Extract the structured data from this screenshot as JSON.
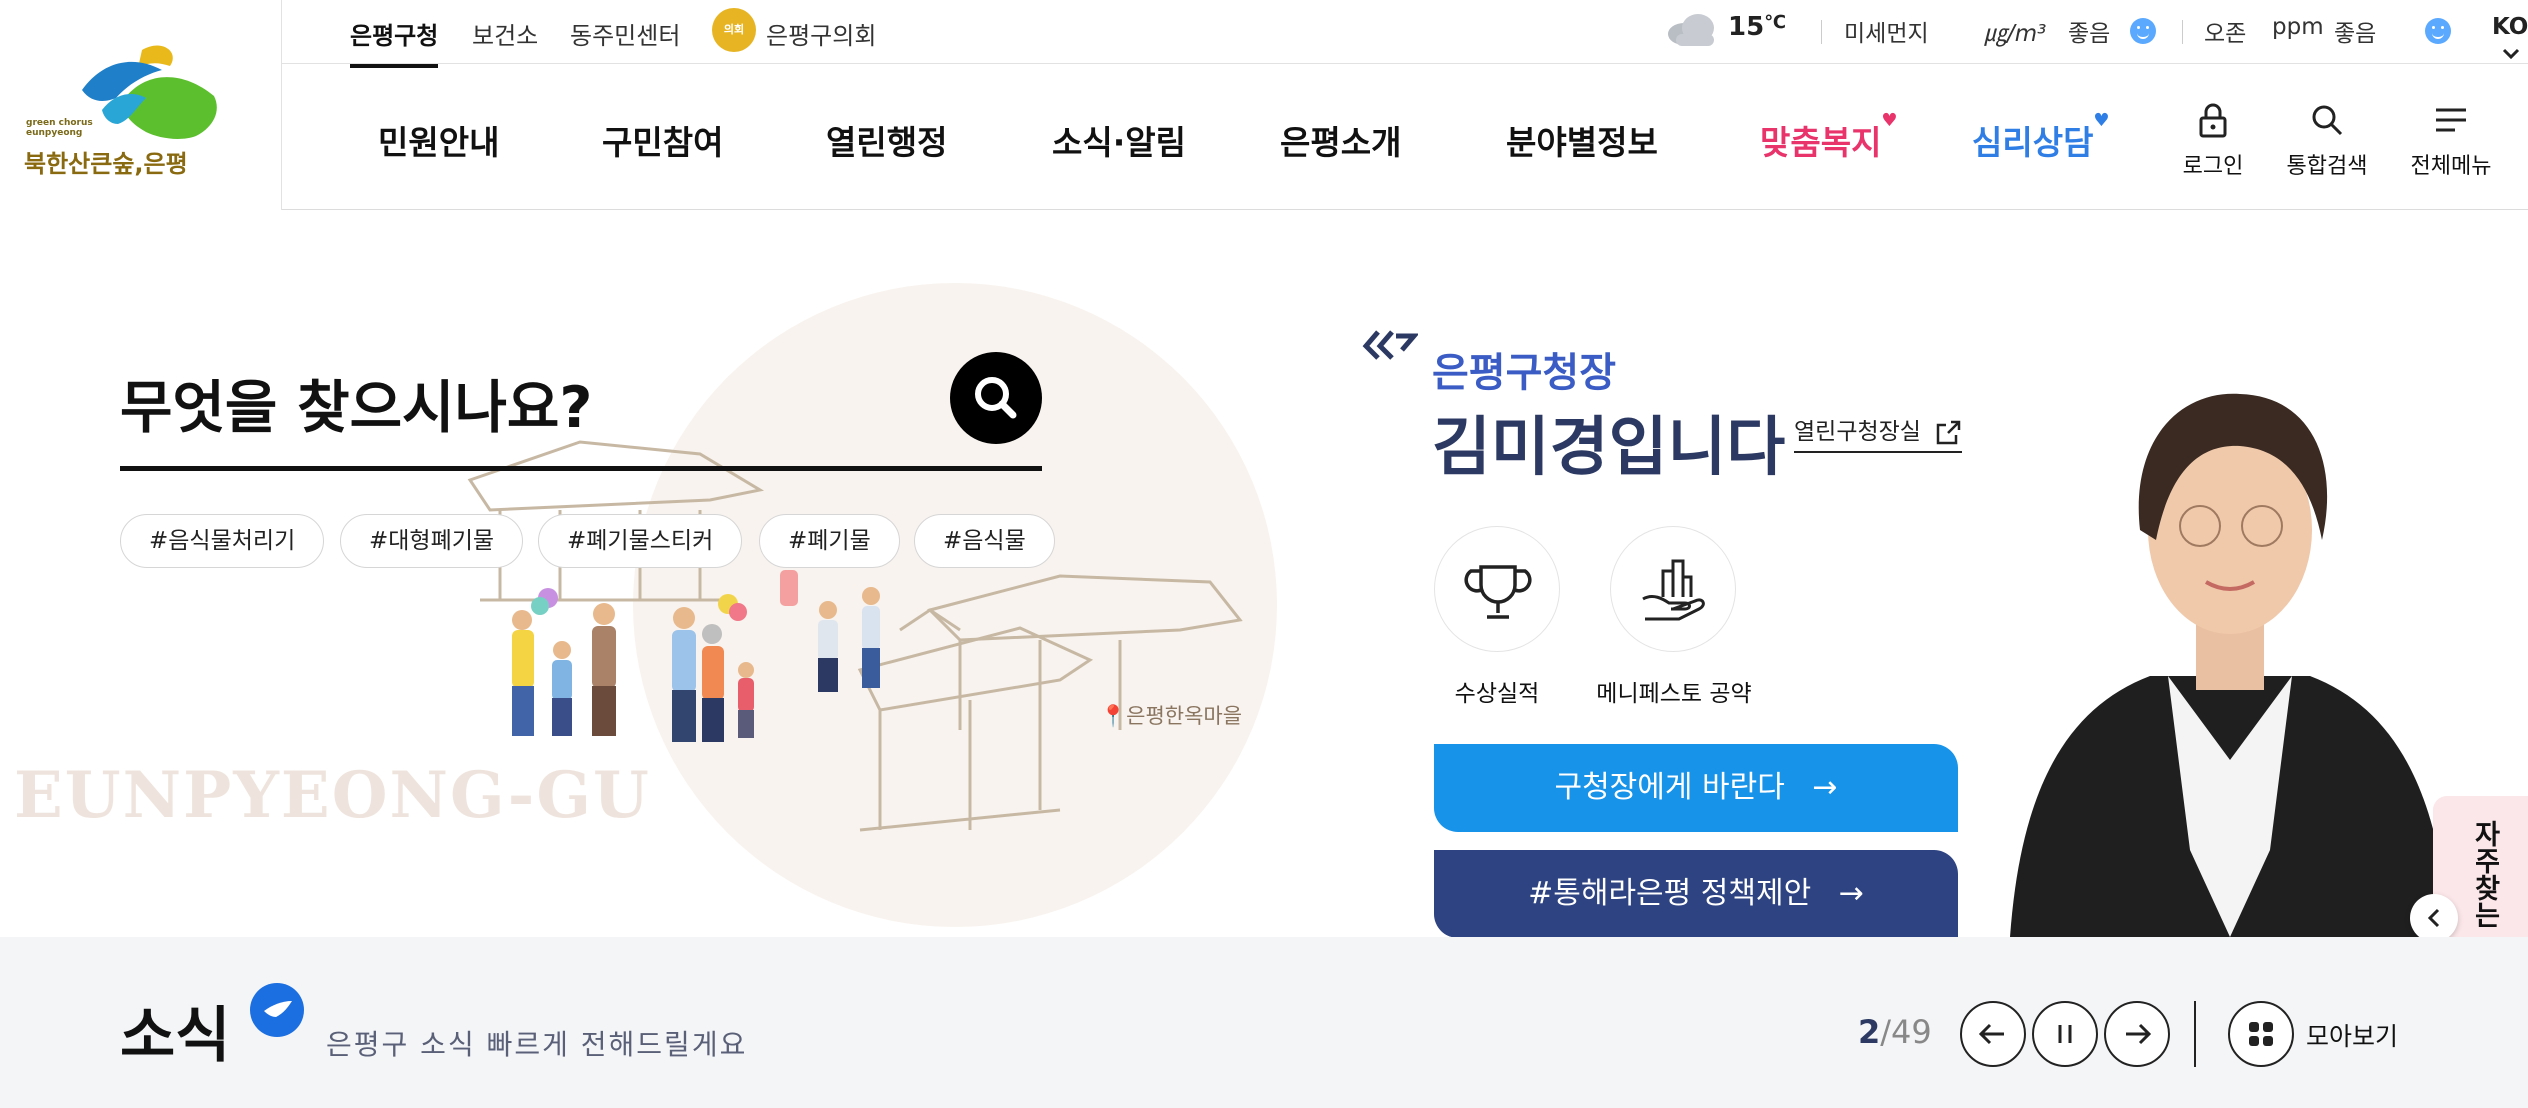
{
  "logo": {
    "small_text_1": "green chorus",
    "small_text_2": "eunpyeong",
    "slogan": "북한산큰숲,은평"
  },
  "util": {
    "sites": [
      "은평구청",
      "보건소",
      "동주민센터"
    ],
    "council": "은평구의회",
    "council_badge": "의회",
    "weather": {
      "temp": "15",
      "unit": "℃"
    },
    "dust": {
      "label": "미세먼지",
      "unit": "㎍/m³",
      "status": "좋음"
    },
    "ozone": {
      "label": "오존",
      "unit": "ppm",
      "status": "좋음"
    },
    "lang": "KOR"
  },
  "nav": {
    "items": [
      "민원안내",
      "구민참여",
      "열린행정",
      "소식·알림",
      "은평소개",
      "분야별정보"
    ],
    "special": [
      {
        "label": "맞춤복지",
        "color": "#e8336b"
      },
      {
        "label": "심리상담",
        "color": "#2f7ee6"
      }
    ],
    "tools": {
      "login": "로그인",
      "search": "통합검색",
      "menu": "전체메뉴"
    }
  },
  "search": {
    "heading": "무엇을 찾으시나요?",
    "tags": [
      "#음식물처리기",
      "#대형폐기물",
      "#폐기물스티커",
      "#폐기물",
      "#음식물"
    ],
    "watermark": "EUNPYEONG-GU",
    "village": "은평한옥마을"
  },
  "mayor": {
    "title": "은평구청장",
    "name": "김미경입니다",
    "link": "열린구청장실",
    "icons": [
      {
        "label": "수상실적",
        "icon": "trophy-icon"
      },
      {
        "label": "메니페스토 공약",
        "icon": "building-hand-icon"
      }
    ],
    "btn1": "구청장에게 바란다",
    "btn2": "#통해라은평 정책제안",
    "arrow": "→"
  },
  "side": {
    "label": "자주찾는 메뉴",
    "dots": "⋮"
  },
  "news": {
    "title": "소식",
    "subtitle": "은평구 소식 빠르게 전해드릴게요",
    "page_current": "2",
    "page_sep": "/",
    "page_total": "49",
    "view_all": "모아보기"
  },
  "colors": {
    "blue_btn": "#1793ea",
    "navy_btn": "#2e4382",
    "mayor_title": "#3a5cc4",
    "mayor_name": "#2c3a63"
  }
}
